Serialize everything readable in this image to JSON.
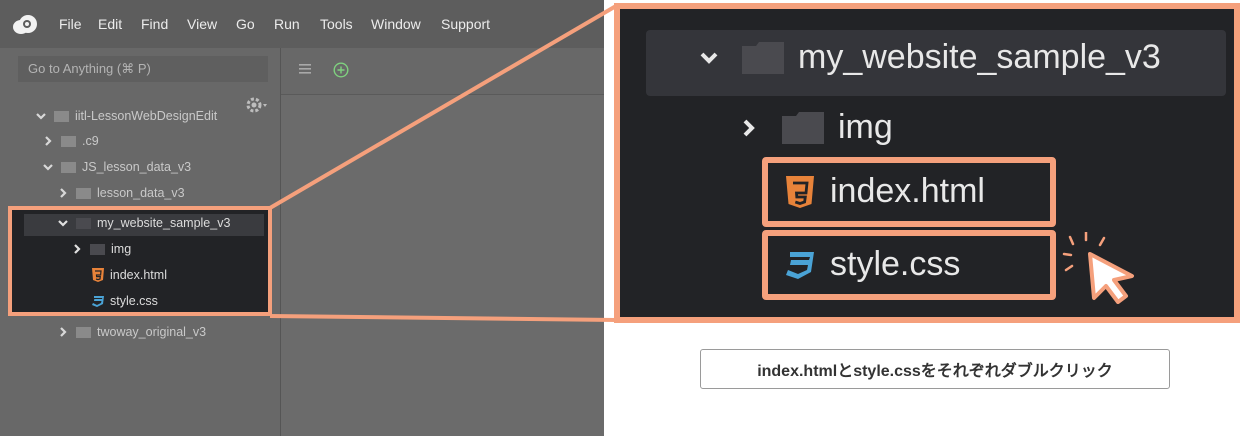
{
  "menubar": {
    "items": [
      "File",
      "Edit",
      "Find",
      "View",
      "Go",
      "Run",
      "Tools",
      "Window",
      "Support"
    ]
  },
  "sidebar": {
    "goto_placeholder": "Go to Anything (⌘ P)",
    "tree": [
      {
        "label": "iitl-LessonWebDesignEdit",
        "kind": "folder",
        "expanded": true
      },
      {
        "label": ".c9",
        "kind": "folder",
        "expanded": false
      },
      {
        "label": "JS_lesson_data_v3",
        "kind": "folder",
        "expanded": true
      },
      {
        "label": "lesson_data_v3",
        "kind": "folder",
        "expanded": false
      },
      {
        "label": "my_website_sample_v3",
        "kind": "folder",
        "expanded": true,
        "selected": true
      },
      {
        "label": "img",
        "kind": "folder",
        "expanded": false
      },
      {
        "label": "index.html",
        "kind": "html"
      },
      {
        "label": "style.css",
        "kind": "css"
      },
      {
        "label": "twoway_original_v3",
        "kind": "folder",
        "expanded": false
      }
    ]
  },
  "zoom": {
    "folder": "my_website_sample_v3",
    "subfolder": "img",
    "files": [
      "index.html",
      "style.css"
    ]
  },
  "caption": "index.htmlとstyle.cssをそれぞれダブルクリック",
  "colors": {
    "highlight": "#f5a07c",
    "html_icon": "#e8833a",
    "css_icon": "#4aa3d6",
    "folder": "#4a4a4f"
  },
  "icons": {
    "logo": "cloud9-logo",
    "gear": "gear-icon",
    "hamburger": "menu-icon",
    "add": "plus-circle-icon",
    "cursor": "pointer-cursor-icon"
  }
}
